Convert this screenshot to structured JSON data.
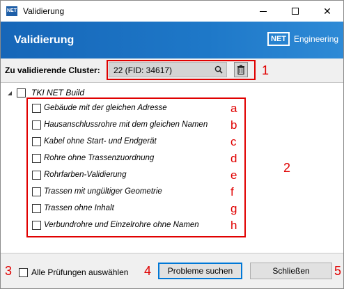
{
  "window": {
    "title": "Validierung",
    "app_icon_text": "NET",
    "controls": {
      "minimize_icon": "minimize-icon",
      "maximize_icon": "maximize-icon",
      "close_glyph": "✕"
    }
  },
  "header": {
    "title": "Validierung",
    "logo_box": "NET",
    "logo_text": "Engineering",
    "accent_color": "#1a6fc0"
  },
  "cluster": {
    "label": "Zu validierende Cluster:",
    "value": "22 (FID: 34617)",
    "search_icon": "search-icon",
    "delete_icon": "trash-icon"
  },
  "tree": {
    "root_label": "TKI NET Build",
    "items": [
      {
        "label": "Gebäude mit der gleichen Adresse",
        "marker": "a"
      },
      {
        "label": "Hausanschlussrohre mit dem gleichen Namen",
        "marker": "b"
      },
      {
        "label": "Kabel ohne Start- und Endgerät",
        "marker": "c"
      },
      {
        "label": "Rohre ohne Trassenzuordnung",
        "marker": "d"
      },
      {
        "label": "Rohrfarben-Validierung",
        "marker": "e"
      },
      {
        "label": "Trassen mit ungültiger Geometrie",
        "marker": "f"
      },
      {
        "label": "Trassen ohne Inhalt",
        "marker": "g"
      },
      {
        "label": "Verbundrohre und Einzelrohre ohne Namen",
        "marker": "h"
      }
    ]
  },
  "footer": {
    "select_all_label": "Alle Prüfungen auswählen",
    "find_button": "Probleme suchen",
    "close_button": "Schließen"
  },
  "annotations": {
    "marker_1": "1",
    "marker_2": "2",
    "marker_3": "3",
    "marker_4": "4",
    "marker_5": "5",
    "color": "#e00000"
  }
}
